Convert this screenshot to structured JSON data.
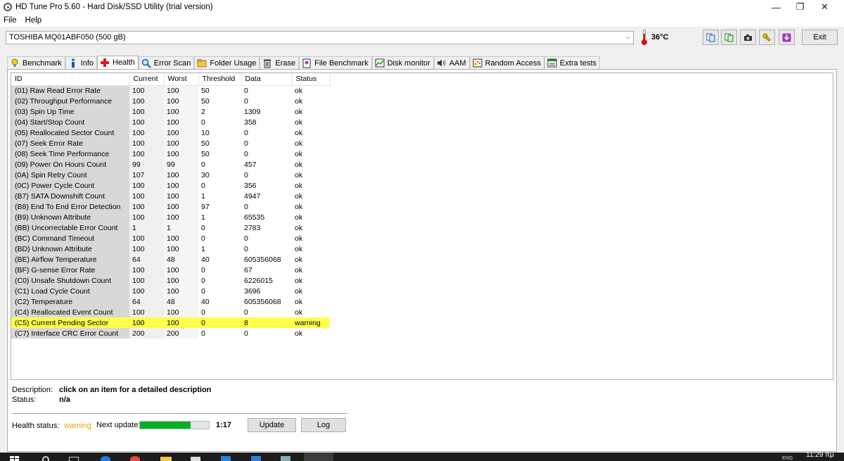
{
  "window": {
    "title": "HD Tune Pro 5.60 - Hard Disk/SSD Utility (trial version)"
  },
  "menu": [
    {
      "label": "File",
      "name": "menu-file"
    },
    {
      "label": "Help",
      "name": "menu-help"
    }
  ],
  "toolbar": {
    "drive": "TOSHIBA MQ01ABF050 (500 gB)",
    "temperature": "36°C",
    "exit_label": "Exit"
  },
  "tabs": [
    {
      "label": "Benchmark",
      "icon": "benchmark-icon",
      "active": false
    },
    {
      "label": "Info",
      "icon": "info-icon",
      "active": false
    },
    {
      "label": "Health",
      "icon": "health-cross-icon",
      "active": true
    },
    {
      "label": "Error Scan",
      "icon": "error-scan-icon",
      "active": false
    },
    {
      "label": "Folder Usage",
      "icon": "folder-icon",
      "active": false
    },
    {
      "label": "Erase",
      "icon": "trash-icon",
      "active": false
    },
    {
      "label": "File Benchmark",
      "icon": "file-benchmark-icon",
      "active": false
    },
    {
      "label": "Disk monitor",
      "icon": "disk-monitor-icon",
      "active": false
    },
    {
      "label": "AAM",
      "icon": "speaker-icon",
      "active": false
    },
    {
      "label": "Random Access",
      "icon": "random-access-icon",
      "active": false
    },
    {
      "label": "Extra tests",
      "icon": "extra-tests-icon",
      "active": false
    }
  ],
  "table": {
    "headers": [
      "ID",
      "Current",
      "Worst",
      "Threshold",
      "Data",
      "Status"
    ],
    "rows": [
      [
        "(01) Raw Read Error Rate",
        "100",
        "100",
        "50",
        "0",
        "ok"
      ],
      [
        "(02) Throughput Performance",
        "100",
        "100",
        "50",
        "0",
        "ok"
      ],
      [
        "(03) Spin Up Time",
        "100",
        "100",
        "2",
        "1309",
        "ok"
      ],
      [
        "(04) Start/Stop Count",
        "100",
        "100",
        "0",
        "358",
        "ok"
      ],
      [
        "(05) Reallocated Sector Count",
        "100",
        "100",
        "10",
        "0",
        "ok"
      ],
      [
        "(07) Seek Error Rate",
        "100",
        "100",
        "50",
        "0",
        "ok"
      ],
      [
        "(08) Seek Time Performance",
        "100",
        "100",
        "50",
        "0",
        "ok"
      ],
      [
        "(09) Power On Hours Count",
        "99",
        "99",
        "0",
        "457",
        "ok"
      ],
      [
        "(0A) Spin Retry Count",
        "107",
        "100",
        "30",
        "0",
        "ok"
      ],
      [
        "(0C) Power Cycle Count",
        "100",
        "100",
        "0",
        "356",
        "ok"
      ],
      [
        "(B7) SATA Downshift Count",
        "100",
        "100",
        "1",
        "4947",
        "ok"
      ],
      [
        "(B8) End To End Error Detection",
        "100",
        "100",
        "97",
        "0",
        "ok"
      ],
      [
        "(B9) Unknown Attribute",
        "100",
        "100",
        "1",
        "65535",
        "ok"
      ],
      [
        "(BB) Uncorrectable Error Count",
        "1",
        "1",
        "0",
        "2783",
        "ok"
      ],
      [
        "(BC) Command Timeout",
        "100",
        "100",
        "0",
        "0",
        "ok"
      ],
      [
        "(BD) Unknown Attribute",
        "100",
        "100",
        "1",
        "0",
        "ok"
      ],
      [
        "(BE) Airflow Temperature",
        "64",
        "48",
        "40",
        "605356068",
        "ok"
      ],
      [
        "(BF) G-sense Error Rate",
        "100",
        "100",
        "0",
        "67",
        "ok"
      ],
      [
        "(C0) Unsafe Shutdown Count",
        "100",
        "100",
        "0",
        "6226015",
        "ok"
      ],
      [
        "(C1) Load Cycle Count",
        "100",
        "100",
        "0",
        "3696",
        "ok"
      ],
      [
        "(C2) Temperature",
        "64",
        "48",
        "40",
        "605356068",
        "ok"
      ],
      [
        "(C4) Reallocated Event Count",
        "100",
        "100",
        "0",
        "0",
        "ok"
      ],
      [
        "(C5) Current Pending Sector",
        "100",
        "100",
        "0",
        "8",
        "warning"
      ],
      [
        "(C7) Interface CRC Error Count",
        "200",
        "200",
        "0",
        "0",
        "ok"
      ]
    ],
    "highlight_row": 22,
    "highlight_color": "#ffff4a"
  },
  "description": {
    "label": "Description:",
    "value": "click on an item for a detailed description",
    "status_label": "Status:",
    "status_value": "n/a"
  },
  "footer": {
    "health_label": "Health status:",
    "health_value": "warning",
    "health_color": "#e0a800",
    "next_update_label": "Next update:",
    "progress_fraction": 0.73,
    "progress_color": "#06b025",
    "time": "1:17",
    "update_label": "Update",
    "log_label": "Log"
  },
  "taskbar": {
    "clock": "11:29 πμ",
    "lang": "ENG"
  }
}
